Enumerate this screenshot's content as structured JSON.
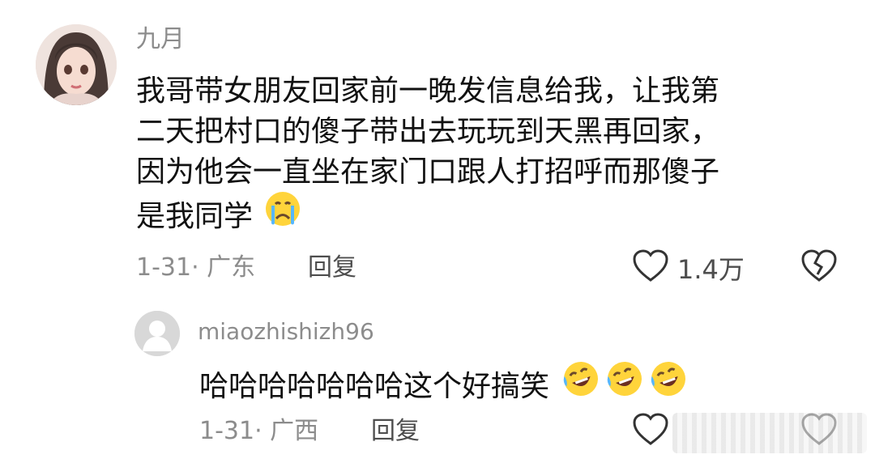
{
  "main_comment": {
    "username": "九月",
    "text_lines": [
      "我哥带女朋友回家前一晚发信息给我，让我第",
      "二天把村口的傻子带出去玩玩到天黑再回家，",
      "因为他会一直坐在家门口跟人打招呼而那傻子",
      "是我同学"
    ],
    "emoji": "crying-face",
    "meta": "1-31· 广东",
    "reply_label": "回复",
    "like_count": "1.4万"
  },
  "reply_comment": {
    "username": "miaozhishizh96",
    "text": "哈哈哈哈哈哈哈这个好搞笑",
    "emojis": [
      "rolling-on-floor-laughing",
      "rolling-on-floor-laughing",
      "rolling-on-floor-laughing"
    ],
    "meta": "1-31· 广西",
    "reply_label": "回复"
  },
  "colors": {
    "username": "#8c8c8c",
    "text": "#111111",
    "meta": "#8c8c8c",
    "action": "#4d4d4d",
    "emoji_face": "#ffd43b",
    "emoji_tear": "#57b7ff"
  }
}
